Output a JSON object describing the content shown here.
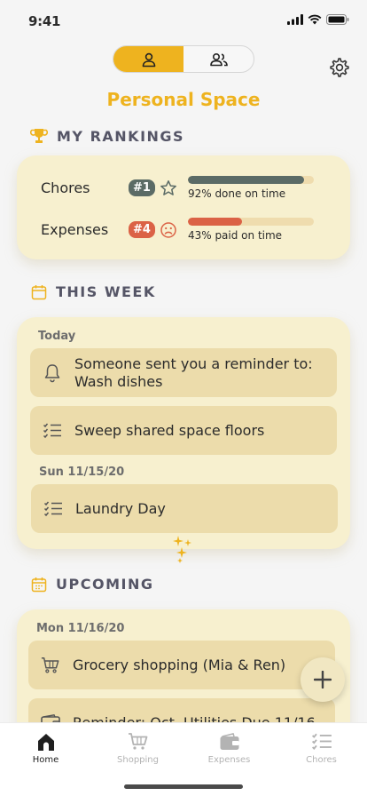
{
  "status_bar": {
    "time": "9:41"
  },
  "segmented": {
    "personal": "person-icon",
    "shared": "people-icon",
    "active": "personal"
  },
  "page_title": "Personal Space",
  "rankings": {
    "heading": "MY RANKINGS",
    "rows": [
      {
        "name": "Chores",
        "rank": "#1",
        "badge_color": "#5b6b66",
        "indicator": "star-icon",
        "progress": 0.92,
        "bar_color": "#5b6b66",
        "caption": "92% done on time"
      },
      {
        "name": "Expenses",
        "rank": "#4",
        "badge_color": "#db6246",
        "indicator": "frown-icon",
        "progress": 0.43,
        "bar_color": "#db6246",
        "caption": "43% paid on time"
      }
    ]
  },
  "this_week": {
    "heading": "THIS WEEK",
    "groups": [
      {
        "label": "Today",
        "items": [
          {
            "icon": "bell-icon",
            "text": "Someone sent you a reminder to: Wash dishes"
          },
          {
            "icon": "checklist-icon",
            "text": "Sweep shared space floors"
          }
        ]
      },
      {
        "label": "Sun 11/15/20",
        "items": [
          {
            "icon": "checklist-icon",
            "text": "Laundry Day"
          }
        ]
      }
    ]
  },
  "upcoming": {
    "heading": "UPCOMING",
    "groups": [
      {
        "label": "Mon 11/16/20",
        "items": [
          {
            "icon": "cart-icon",
            "text": "Grocery shopping (Mia & Ren)"
          },
          {
            "icon": "wallet-icon",
            "text": "Reminder: Oct. Utilities Due 11/16"
          }
        ]
      }
    ]
  },
  "tabs": [
    {
      "label": "Home",
      "icon": "home-icon",
      "active": true
    },
    {
      "label": "Shopping",
      "icon": "cart-icon",
      "active": false
    },
    {
      "label": "Expenses",
      "icon": "wallet-icon",
      "active": false
    },
    {
      "label": "Chores",
      "icon": "checklist-icon",
      "active": false
    }
  ],
  "colors": {
    "accent": "#eeb31f",
    "card": "#f7f0cf",
    "item": "#ecdcab",
    "heading": "#555566"
  }
}
